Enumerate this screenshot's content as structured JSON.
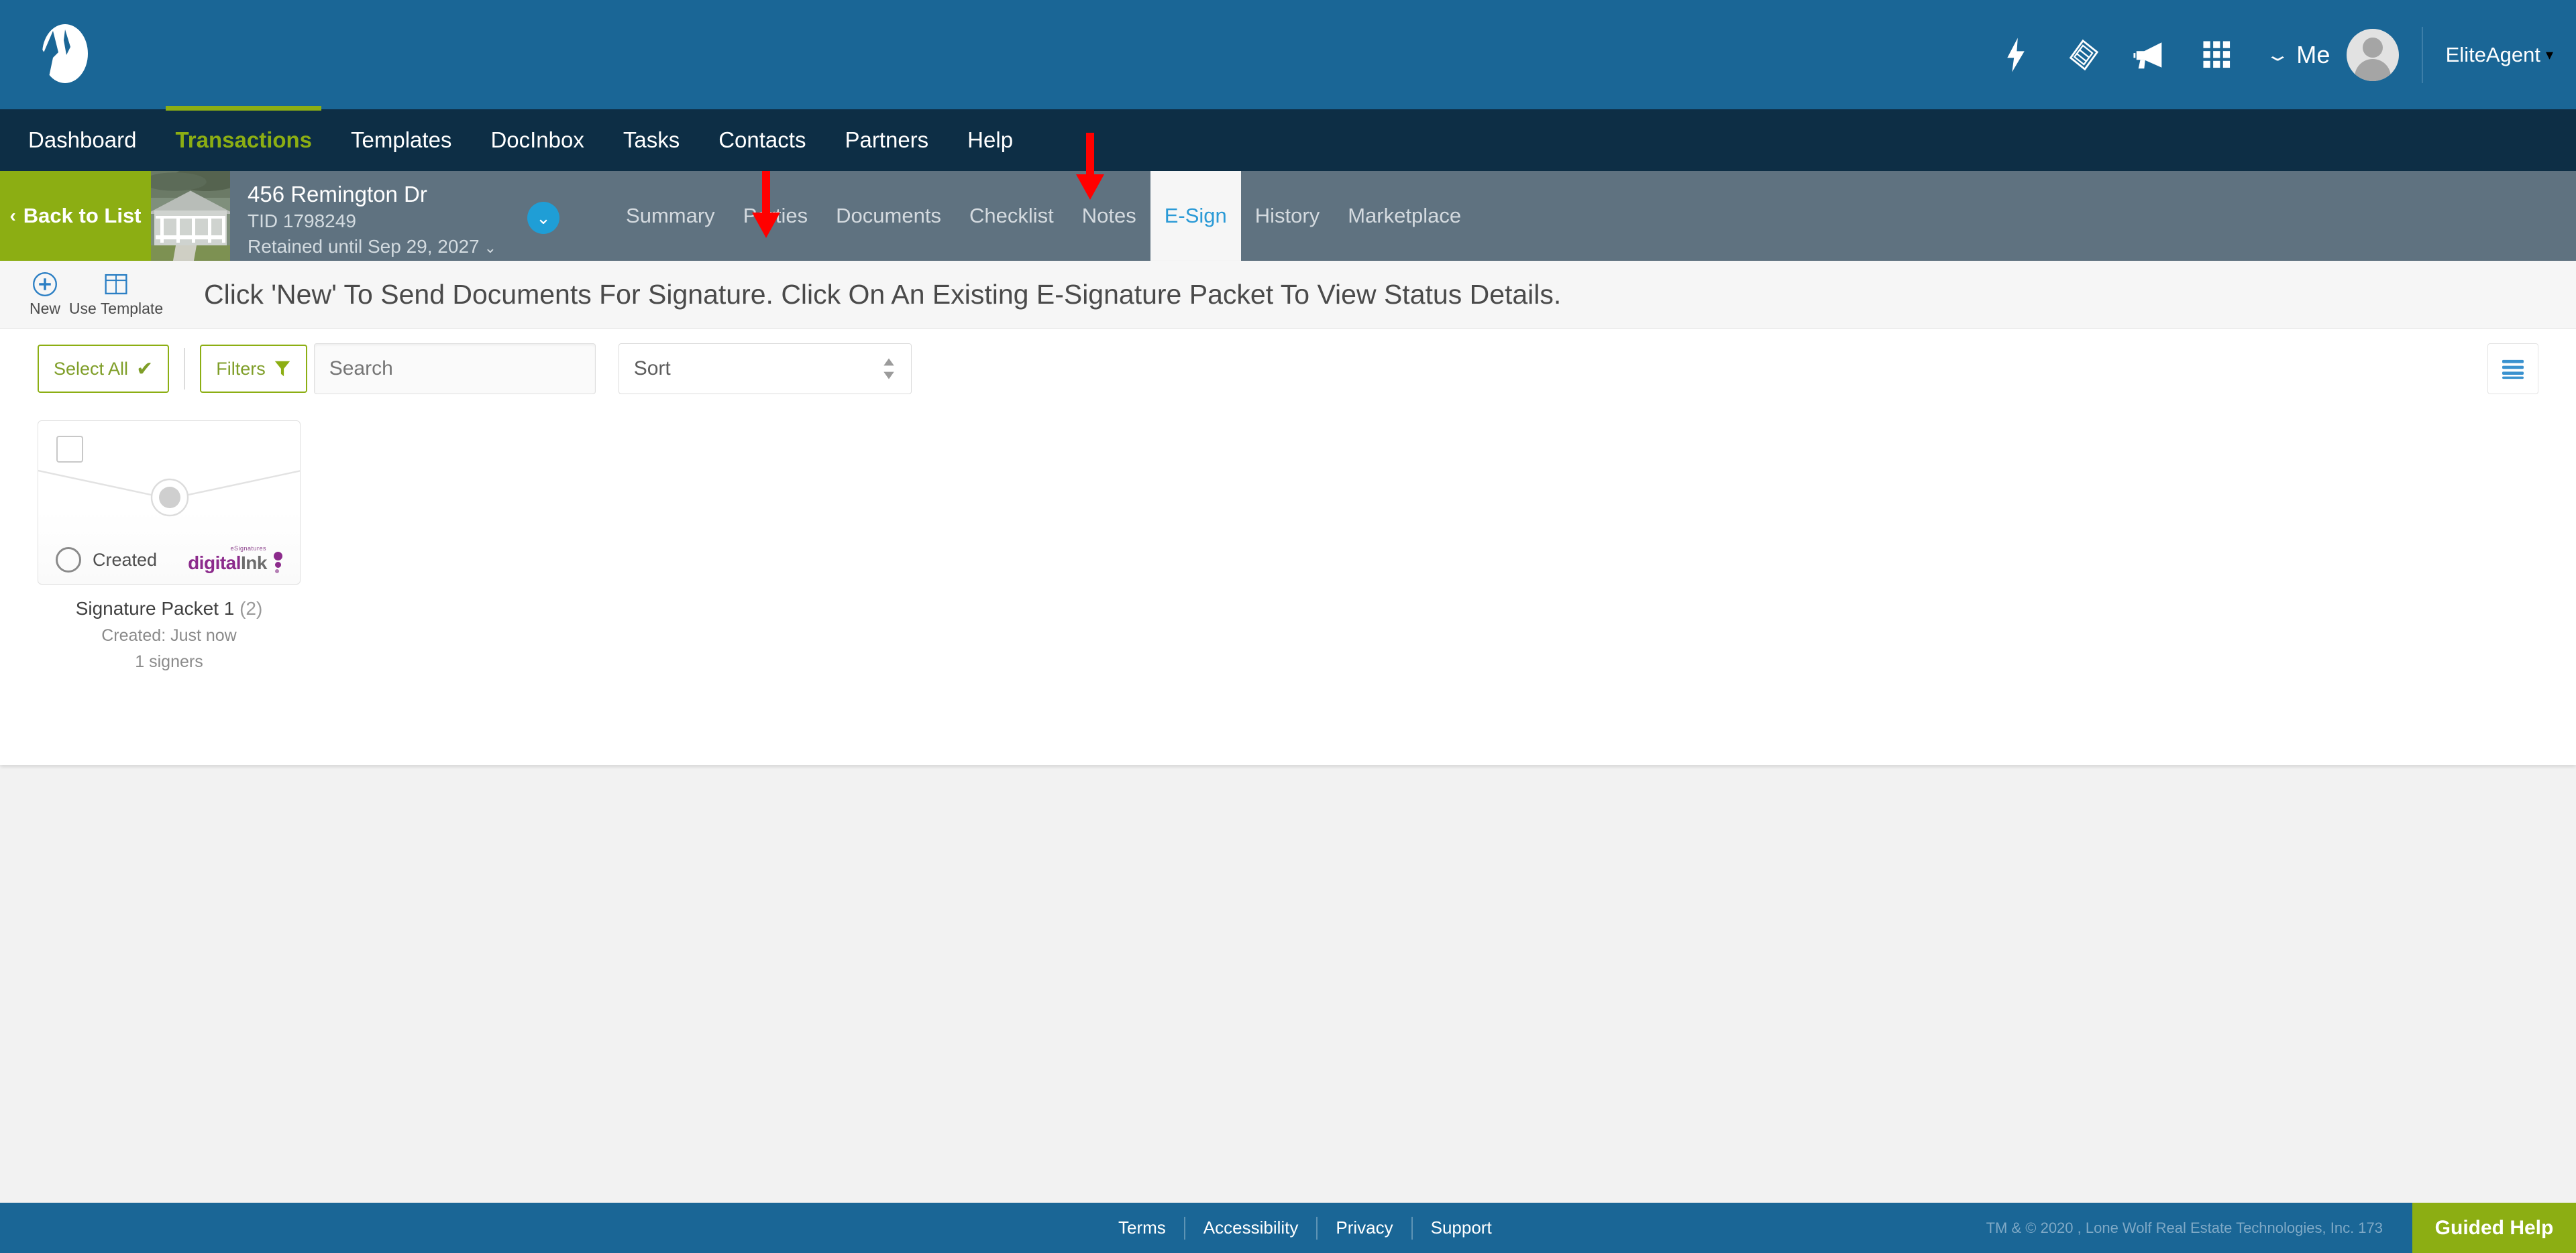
{
  "header": {
    "brand_color": "#1a6696",
    "nav_bg": "#0d2e45",
    "accent_green": "#8cae13",
    "icons": [
      {
        "name": "lightning-bolt-icon"
      },
      {
        "name": "handshake-icon"
      },
      {
        "name": "megaphone-icon"
      },
      {
        "name": "grid-apps-icon"
      }
    ],
    "me_caret": "⌄",
    "me_label": "Me",
    "account_label": "EliteAgent",
    "account_caret": "▾"
  },
  "mainnav": {
    "items": [
      {
        "label": "Dashboard",
        "active": false
      },
      {
        "label": "Transactions",
        "active": true
      },
      {
        "label": "Templates",
        "active": false
      },
      {
        "label": "DocInbox",
        "active": false
      },
      {
        "label": "Tasks",
        "active": false
      },
      {
        "label": "Contacts",
        "active": false
      },
      {
        "label": "Partners",
        "active": false
      },
      {
        "label": "Help",
        "active": false
      }
    ]
  },
  "transaction": {
    "back_chevron": "‹",
    "back_label": "Back to List",
    "address": "456 Remington Dr",
    "tid": "TID 1798249",
    "retained": "Retained until Sep 29, 2027",
    "retained_caret": "⌄",
    "expand_caret": "⌄",
    "subtabs": [
      {
        "label": "Summary",
        "active": false
      },
      {
        "label": "Parties",
        "active": false
      },
      {
        "label": "Documents",
        "active": false
      },
      {
        "label": "Checklist",
        "active": false
      },
      {
        "label": "Notes",
        "active": false
      },
      {
        "label": "E-Sign",
        "active": true
      },
      {
        "label": "History",
        "active": false
      },
      {
        "label": "Marketplace",
        "active": false
      }
    ]
  },
  "toolbar": {
    "new_label": "New",
    "use_template_label": "Use Template",
    "hint": "Click 'New' To Send Documents For Signature. Click On An Existing E-Signature Packet To View Status Details."
  },
  "filters": {
    "select_all_label": "Select All",
    "select_all_check": "✔",
    "filters_label": "Filters",
    "search_placeholder": "Search",
    "search_value": "",
    "sort_label": "Sort",
    "sort_arrows": "↕",
    "list_view_icon": "list-view-icon"
  },
  "packets": [
    {
      "status": "Created",
      "vendor_tagline": "eSignatures",
      "vendor_name_bold": "digital",
      "vendor_name_light": "Ink",
      "title": "Signature Packet 1",
      "count": "(2)",
      "created": "Created: Just now",
      "signers": "1 signers",
      "checked": false
    }
  ],
  "footer": {
    "links": [
      "Terms",
      "Accessibility",
      "Privacy",
      "Support"
    ],
    "copyright": "TM & © 2020 , Lone Wolf Real Estate Technologies, Inc. 173",
    "guided_help": "Guided Help"
  },
  "annotations": {
    "arrow_color": "#ff0000",
    "arrows": [
      {
        "name": "arrow-pointing-to-parties-documents"
      },
      {
        "name": "arrow-pointing-to-esign-tab"
      }
    ]
  }
}
